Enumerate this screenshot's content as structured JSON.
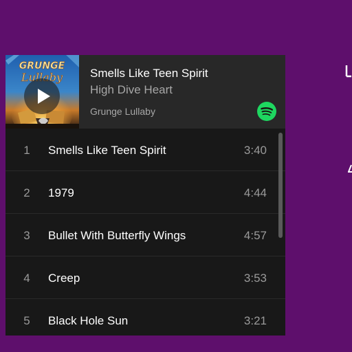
{
  "now_playing": {
    "title": "Smells Like Teen Spirit",
    "artist": "High Dive Heart",
    "album": "Grunge Lullaby",
    "cover_text_top": "GRUNGE",
    "cover_text_bottom": "Lullaby"
  },
  "tracks": [
    {
      "number": "1",
      "title": "Smells Like Teen Spirit",
      "duration": "3:40"
    },
    {
      "number": "2",
      "title": "1979",
      "duration": "4:44"
    },
    {
      "number": "3",
      "title": "Bullet With Butterfly Wings",
      "duration": "4:57"
    },
    {
      "number": "4",
      "title": "Creep",
      "duration": "3:53"
    },
    {
      "number": "5",
      "title": "Black Hole Sun",
      "duration": "3:21"
    }
  ],
  "icons": {
    "play": "play-icon",
    "brand": "spotify-logo-icon"
  },
  "colors": {
    "page_background": "#5e0f6c",
    "widget_background": "#181818",
    "header_background": "#282828",
    "spotify_green": "#1ed760"
  }
}
